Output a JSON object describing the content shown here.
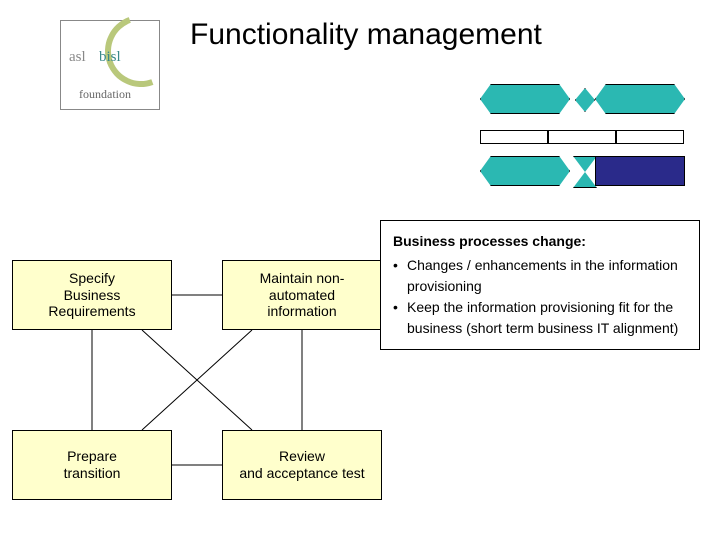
{
  "logo": {
    "word1": "asl",
    "word2": "bisl",
    "foundation": "foundation"
  },
  "title": "Functionality management",
  "flow": {
    "top_left": "Specify\nBusiness\nRequirements",
    "top_right": "Maintain non-\nautomated\ninformation",
    "bottom_left": "Prepare\ntransition",
    "bottom_right": "Review\nand acceptance test"
  },
  "callout": {
    "heading": "Business processes change:",
    "bullet1": "Changes / enhancements in the information provisioning",
    "bullet2": "Keep the information provisioning  fit for the business (short term business IT alignment)"
  }
}
